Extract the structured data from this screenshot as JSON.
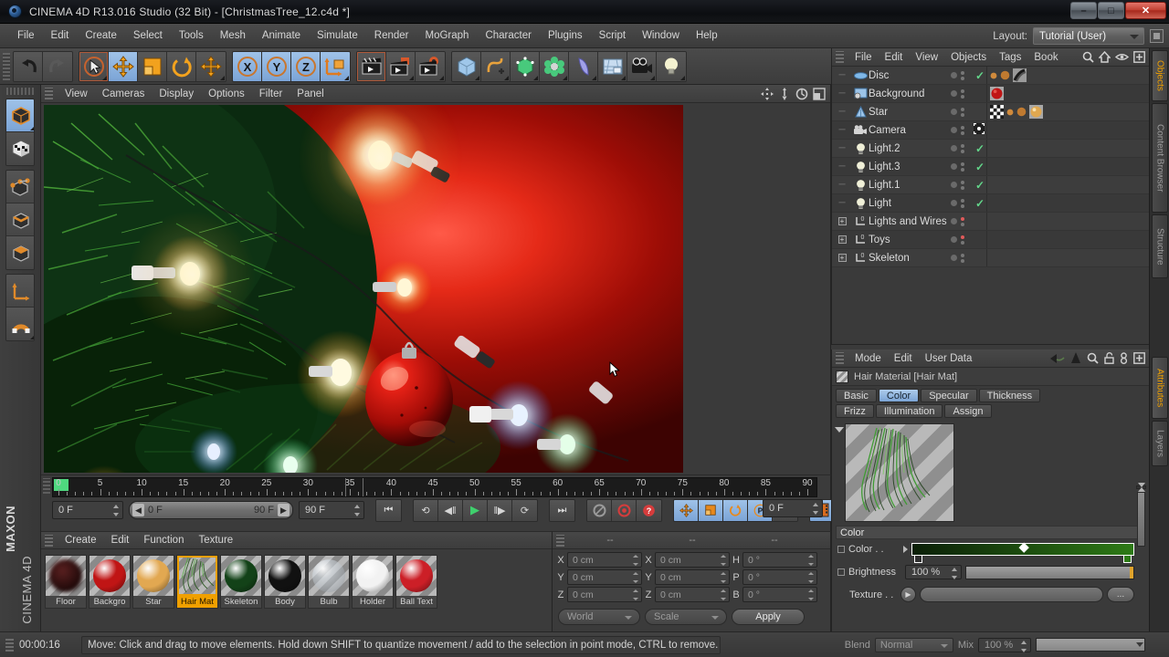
{
  "window": {
    "title": "CINEMA 4D R13.016 Studio (32 Bit) - [ChristmasTree_12.c4d *]",
    "minimize": "–",
    "maximize": "☐",
    "close": "✕"
  },
  "menubar": {
    "items": [
      "File",
      "Edit",
      "Create",
      "Select",
      "Tools",
      "Mesh",
      "Animate",
      "Simulate",
      "Render",
      "MoGraph",
      "Character",
      "Plugins",
      "Script",
      "Window",
      "Help"
    ],
    "layout_label": "Layout:",
    "layout_value": "Tutorial (User)"
  },
  "toolbar": {
    "groups": [
      {
        "name": "history",
        "buttons": [
          {
            "name": "undo-button",
            "icon": "↶",
            "color": "#2a2a2a",
            "active": false
          },
          {
            "name": "redo-button",
            "icon": "↷",
            "color": "#5a5a5a",
            "active": false
          }
        ]
      },
      {
        "name": "transform",
        "buttons": [
          {
            "name": "live-selection-tool",
            "icon": "➤",
            "color": "#e8e8e8",
            "active": false
          },
          {
            "name": "move-tool",
            "icon": "✥",
            "color": "#f0a000",
            "active": true
          },
          {
            "name": "scale-tool",
            "icon": "◧",
            "color": "#f0a000",
            "active": false
          },
          {
            "name": "rotate-tool",
            "icon": "↻",
            "color": "#f0a000",
            "active": false
          },
          {
            "name": "move-tool-alt",
            "icon": "✥",
            "color": "#f0a000",
            "active": false
          }
        ]
      },
      {
        "name": "axis-locks",
        "buttons": [
          {
            "name": "x-axis-lock",
            "icon": "X",
            "color": "#1a1a1a",
            "active": true
          },
          {
            "name": "y-axis-lock",
            "icon": "Y",
            "color": "#1a1a1a",
            "active": true
          },
          {
            "name": "z-axis-lock",
            "icon": "Z",
            "color": "#1a1a1a",
            "active": true
          },
          {
            "name": "world-object-axis",
            "icon": "⤴",
            "color": "#f0a000",
            "active": true
          }
        ]
      },
      {
        "name": "render",
        "buttons": [
          {
            "name": "render-view-button",
            "icon": "▶",
            "color": "#e0e0e0",
            "active": false
          },
          {
            "name": "render-region-button",
            "icon": "▶",
            "color": "#e0e0e0",
            "active": false
          },
          {
            "name": "render-settings-button",
            "icon": "▶",
            "color": "#e0e0e0",
            "active": false
          }
        ]
      },
      {
        "name": "objects",
        "buttons": [
          {
            "name": "add-cube-object",
            "icon": "⬛",
            "color": "#9cc6ea",
            "active": false
          },
          {
            "name": "add-spline-object",
            "icon": "∿",
            "color": "#f0a000",
            "active": false
          },
          {
            "name": "add-generator-object",
            "icon": "⬛",
            "color": "#46c87a",
            "active": false
          },
          {
            "name": "add-mograph-object",
            "icon": "✵",
            "color": "#46c87a",
            "active": false
          },
          {
            "name": "add-deformer-object",
            "icon": "◖",
            "color": "#9a9ae8",
            "active": false
          },
          {
            "name": "add-environment-object",
            "icon": "▤",
            "color": "#bcd4ec",
            "active": false
          },
          {
            "name": "add-camera-object",
            "icon": "●●",
            "color": "#1e1e1e",
            "active": false
          },
          {
            "name": "add-light-object",
            "icon": "●",
            "color": "#f2f2c0",
            "active": false
          }
        ]
      }
    ]
  },
  "left_palette": {
    "buttons": [
      {
        "name": "model-mode-button",
        "icon": "⬛",
        "active": true
      },
      {
        "name": "texture-mode-button",
        "icon": "▦",
        "active": false
      },
      {
        "name": "points-mode-button",
        "icon": "⬛",
        "active": false
      },
      {
        "name": "edges-mode-button",
        "icon": "⬛",
        "active": false
      },
      {
        "name": "polygons-mode-button",
        "icon": "⬛",
        "active": false
      },
      {
        "name": "axis-modify-button",
        "icon": "⤴",
        "active": false
      },
      {
        "name": "enable-snap-button",
        "icon": "⫫",
        "active": false
      }
    ],
    "brand_top": "MAXON",
    "brand_bottom": "CINEMA 4D"
  },
  "viewport": {
    "menus": [
      "View",
      "Cameras",
      "Display",
      "Options",
      "Filter",
      "Panel"
    ],
    "corner_icons": [
      "pan-icon",
      "dolly-icon",
      "rotate-icon",
      "maximize-view-icon"
    ],
    "scene_description": "Christmas tree close-up with red ornament and string lights on red background"
  },
  "timeline": {
    "ticks": [
      0,
      5,
      10,
      15,
      20,
      25,
      30,
      35,
      40,
      45,
      50,
      55,
      60,
      65,
      70,
      75,
      80,
      85,
      90
    ],
    "min_frame": 0,
    "max_frame": 90,
    "current_frame": "0 F",
    "preview_min": "0 F",
    "preview_max": "90 F",
    "doc_end": "90 F",
    "current_frame_right": "0 F",
    "playback": [
      {
        "name": "go-to-start-button",
        "icon": "⏮"
      },
      {
        "name": "go-to-previous-key-button",
        "icon": "⟲"
      },
      {
        "name": "go-to-previous-frame-button",
        "icon": "◀❘"
      },
      {
        "name": "play-button",
        "icon": "▶",
        "accent": "#3fd06d"
      },
      {
        "name": "go-to-next-frame-button",
        "icon": "❘▶"
      },
      {
        "name": "go-to-next-key-button",
        "icon": "⟳"
      },
      {
        "name": "go-to-end-button",
        "icon": "⏭"
      }
    ],
    "record_group": [
      {
        "name": "record-active-objects-button",
        "icon": "◉",
        "color": "#9a9a9a"
      },
      {
        "name": "autokeying-button",
        "icon": "◎",
        "color": "#d63c3c"
      },
      {
        "name": "keyframe-selection-button",
        "icon": "?",
        "color": "#d63c3c"
      }
    ],
    "key_group": [
      {
        "name": "position-key-button",
        "icon": "✥",
        "active": true
      },
      {
        "name": "scale-key-button",
        "icon": "◧",
        "active": true
      },
      {
        "name": "rotation-key-button",
        "icon": "↻",
        "active": true
      },
      {
        "name": "param-key-button",
        "icon": "P",
        "active": true
      },
      {
        "name": "point-level-animation-button",
        "icon": "∷",
        "active": false
      }
    ],
    "film_button": {
      "name": "timeline-button",
      "icon": "▓"
    }
  },
  "material_manager": {
    "menus": [
      "Create",
      "Edit",
      "Function",
      "Texture"
    ],
    "materials": [
      {
        "name": "Floor",
        "color": "#5a2020",
        "type": "dark",
        "selected": false
      },
      {
        "name": "Backgro",
        "color": "#c01515",
        "type": "ball",
        "selected": false
      },
      {
        "name": "Star",
        "color": "#e2a851",
        "type": "ball",
        "selected": false
      },
      {
        "name": "Hair Mat",
        "color": "#2d5a24",
        "type": "hair",
        "selected": true
      },
      {
        "name": "Skeleton",
        "color": "#134218",
        "type": "ball",
        "selected": false
      },
      {
        "name": "Body",
        "color": "#111111",
        "type": "ball",
        "selected": false
      },
      {
        "name": "Bulb",
        "color": "#c9cfd4",
        "type": "glass",
        "selected": false
      },
      {
        "name": "Holder",
        "color": "#f2f2f2",
        "type": "ball",
        "selected": false
      },
      {
        "name": "Ball Text",
        "color": "#cc1f27",
        "type": "ball",
        "selected": false
      }
    ]
  },
  "coordinates": {
    "headers": [
      "--",
      "--",
      "--"
    ],
    "rows": [
      {
        "pos_label": "X",
        "pos_value": "0 cm",
        "size_label": "X",
        "size_value": "0 cm",
        "rot_label": "H",
        "rot_value": "0 °"
      },
      {
        "pos_label": "Y",
        "pos_value": "0 cm",
        "size_label": "Y",
        "size_value": "0 cm",
        "rot_label": "P",
        "rot_value": "0 °"
      },
      {
        "pos_label": "Z",
        "pos_value": "0 cm",
        "size_label": "Z",
        "size_value": "0 cm",
        "rot_label": "B",
        "rot_value": "0 °"
      }
    ],
    "system": "World",
    "mode": "Scale",
    "apply": "Apply"
  },
  "object_manager": {
    "menus": [
      "File",
      "Edit",
      "View",
      "Objects",
      "Tags",
      "Book"
    ],
    "header_icons": [
      "search-icon",
      "home-icon",
      "eye-icon",
      "add-icon"
    ],
    "objects": [
      {
        "name": "Disc",
        "icon": "disc-icon",
        "icon_color": "#7fb8e8",
        "expandable": false,
        "visible_check": true,
        "dot_red": false,
        "tags": [
          "dot-small",
          "dot-medium",
          "hair-tag"
        ]
      },
      {
        "name": "Background",
        "icon": "background-icon",
        "icon_color": "#8fb8dc",
        "expandable": false,
        "visible_check": false,
        "dot_red": false,
        "tags": [
          "red-ball-tag"
        ]
      },
      {
        "name": "Star",
        "icon": "star-icon",
        "icon_color": "#8fb8dc",
        "expandable": false,
        "visible_check": false,
        "dot_red": false,
        "tags": [
          "checker-tag",
          "dot-small",
          "dot-medium",
          "gold-ball-tag"
        ]
      },
      {
        "name": "Camera",
        "icon": "camera-icon",
        "icon_color": "#d4d4d4",
        "expandable": false,
        "visible_check": false,
        "target_tag": true,
        "dot_red": false,
        "tags": []
      },
      {
        "name": "Light.2",
        "icon": "light-icon",
        "icon_color": "#e8e8c8",
        "expandable": false,
        "visible_check": true,
        "dot_red": false,
        "tags": []
      },
      {
        "name": "Light.3",
        "icon": "light-icon",
        "icon_color": "#e8e8c8",
        "expandable": false,
        "visible_check": true,
        "dot_red": false,
        "tags": []
      },
      {
        "name": "Light.1",
        "icon": "light-icon",
        "icon_color": "#e8e8c8",
        "expandable": false,
        "visible_check": true,
        "dot_red": false,
        "tags": []
      },
      {
        "name": "Light",
        "icon": "light-icon",
        "icon_color": "#e8e8c8",
        "expandable": false,
        "visible_check": true,
        "dot_red": false,
        "tags": []
      },
      {
        "name": "Lights and Wires",
        "icon": "null-object-icon",
        "icon_color": "#c8c8c8",
        "expandable": true,
        "visible_check": false,
        "dot_red": true,
        "tags": []
      },
      {
        "name": "Toys",
        "icon": "null-object-icon",
        "icon_color": "#c8c8c8",
        "expandable": true,
        "visible_check": false,
        "dot_red": true,
        "tags": []
      },
      {
        "name": "Skeleton",
        "icon": "null-object-icon",
        "icon_color": "#c8c8c8",
        "expandable": true,
        "visible_check": false,
        "dot_red": false,
        "tags": []
      }
    ]
  },
  "attributes": {
    "menus": [
      "Mode",
      "Edit",
      "User Data"
    ],
    "header_icons": [
      "back-icon",
      "forward-icon",
      "up-icon",
      "search-icon",
      "lock-icon",
      "link-icon",
      "add-icon"
    ],
    "title": "Hair Material [Hair Mat]",
    "tabs_row1": [
      {
        "label": "Basic",
        "active": false
      },
      {
        "label": "Color",
        "active": true
      },
      {
        "label": "Specular",
        "active": false
      },
      {
        "label": "Thickness",
        "active": false
      }
    ],
    "tabs_row2": [
      {
        "label": "Frizz",
        "active": false
      },
      {
        "label": "Illumination",
        "active": false
      },
      {
        "label": "Assign",
        "active": false
      }
    ],
    "section_title": "Color",
    "color_label": "Color . .",
    "color_gradient_start": "#0b1f07",
    "color_gradient_end": "#2e7a16",
    "brightness_label": "Brightness",
    "brightness_value": "100 %",
    "texture_label": "Texture . .",
    "texture_dots": "...",
    "blend_label": "Blend",
    "blend_value": "Normal",
    "mix_label": "Mix",
    "mix_value": "100 %"
  },
  "side_tabs": {
    "top": [
      {
        "label": "Objects",
        "active": true
      },
      {
        "label": "Content Browser",
        "active": false
      },
      {
        "label": "Structure",
        "active": false
      }
    ],
    "bottom": [
      {
        "label": "Attributes",
        "active": true
      },
      {
        "label": "Layers",
        "active": false
      }
    ]
  },
  "statusbar": {
    "time": "00:00:16",
    "message": "Move: Click and drag to move elements. Hold down SHIFT to quantize movement / add to the selection in point mode, CTRL to remove."
  }
}
